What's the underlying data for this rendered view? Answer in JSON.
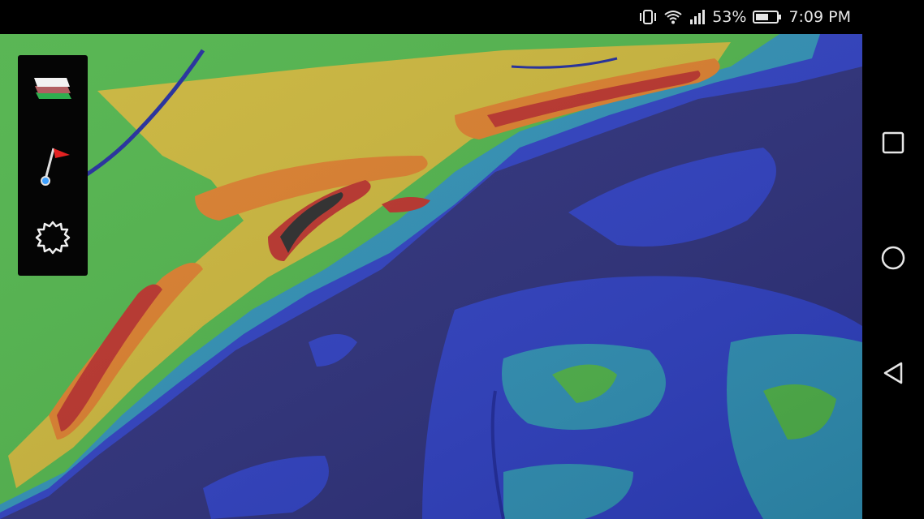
{
  "status_bar": {
    "battery_percent": "53%",
    "time": "7:09 PM",
    "icons": [
      "vibrate-icon",
      "wifi-icon",
      "signal-icon",
      "battery-icon"
    ]
  },
  "toolbar": {
    "buttons": [
      "layers-icon",
      "flag-pin-icon",
      "settings-gear-icon"
    ]
  },
  "navigation": {
    "buttons": [
      "recent-apps-square-icon",
      "home-circle-icon",
      "back-triangle-icon"
    ]
  },
  "map": {
    "type": "elevation-relief",
    "colors": {
      "lowland": "#2c2f7a",
      "low": "#2e3fc0",
      "teal": "#2f8fb4",
      "green": "#4fb24a",
      "yellow": "#c9b43a",
      "orange": "#d97d2b",
      "red": "#b8322a",
      "peak": "#2a2a2a"
    }
  }
}
